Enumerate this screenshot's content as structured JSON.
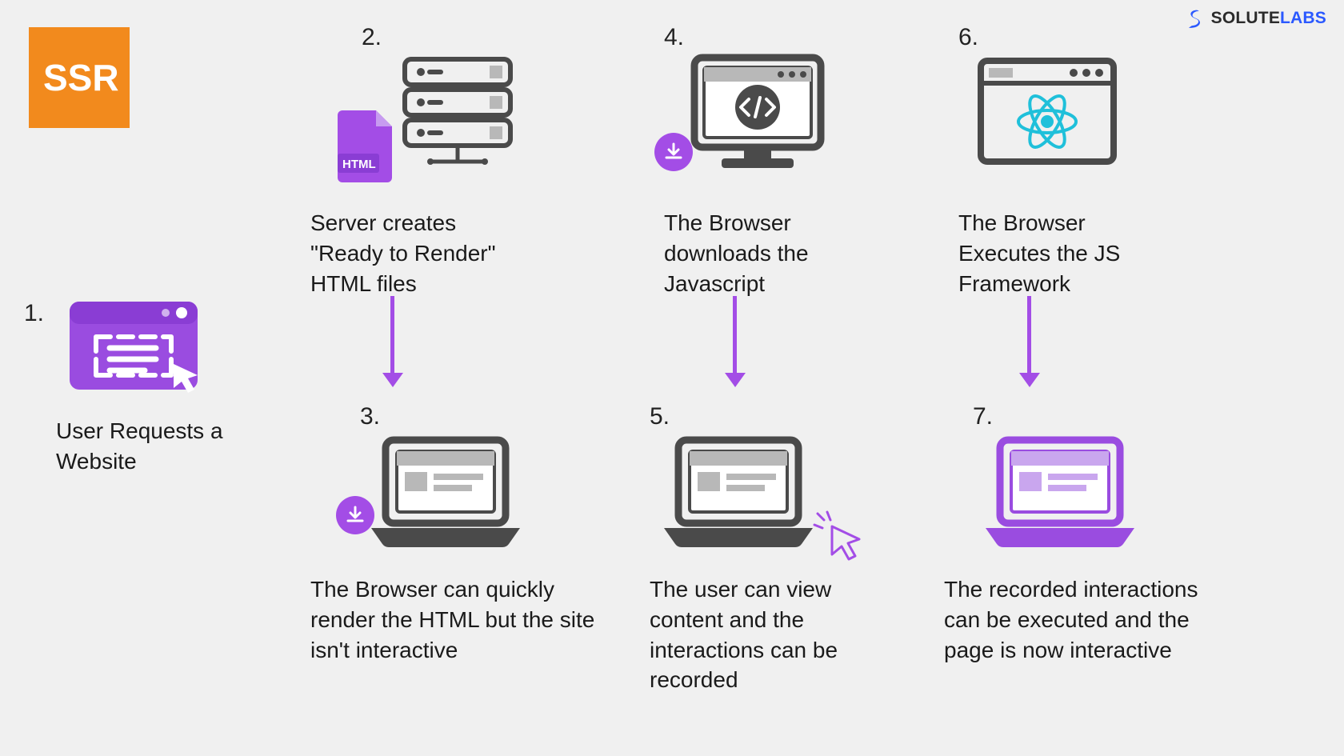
{
  "badge": {
    "label": "SSR"
  },
  "logo": {
    "part1": "SOLUTE",
    "part2": "LABS"
  },
  "steps": {
    "s1": {
      "num": "1.",
      "text": "User Requests a Website"
    },
    "s2": {
      "num": "2.",
      "text": "Server creates \"Ready to Render\" HTML files",
      "file_label": "HTML"
    },
    "s3": {
      "num": "3.",
      "text": "The Browser can quickly render the HTML but the site isn't interactive"
    },
    "s4": {
      "num": "4.",
      "text": "The Browser downloads the Javascript"
    },
    "s5": {
      "num": "5.",
      "text": "The user can view content and the interactions can be recorded"
    },
    "s6": {
      "num": "6.",
      "text": "The Browser Executes the JS Framework"
    },
    "s7": {
      "num": "7.",
      "text": "The recorded interactions can be executed and the page is now interactive"
    }
  },
  "colors": {
    "accent_purple": "#a34de6",
    "dark_gray": "#4a4a4a",
    "react_cyan": "#1fc0da"
  }
}
